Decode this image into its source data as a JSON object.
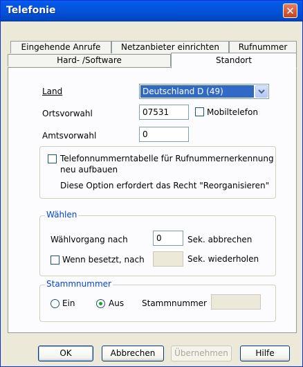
{
  "window": {
    "title": "Telefonie"
  },
  "tabs": {
    "row_back": [
      "Eingehende Anrufe",
      "Netzanbieter einrichten",
      "Rufnummer"
    ],
    "row_front": [
      "Hard- /Software",
      "Standort"
    ],
    "active": "Standort"
  },
  "location": {
    "country_label": "Land",
    "country_value": "Deutschland D (49)",
    "area_code_label": "Ortsvorwahl",
    "area_code_value": "07531",
    "mobile_label": "Mobiltelefon",
    "mobile_checked": false,
    "outside_line_label": "Amtsvorwahl",
    "outside_line_value": "0"
  },
  "rebuild": {
    "checkbox_label_line1": "Telefonnummerntabelle für Rufnummernerkennung",
    "checkbox_label_line2": "neu aufbauen",
    "checked": false,
    "note": "Diese Option erfordert das Recht \"Reorganisieren\""
  },
  "dialing": {
    "legend": "Wählen",
    "abort_label": "Wählvorgang nach",
    "abort_value": "0",
    "abort_suffix": "Sek. abbrechen",
    "busy_label": "Wenn besetzt, nach",
    "busy_checked": false,
    "busy_value": "",
    "busy_suffix": "Sek. wiederholen"
  },
  "trunk": {
    "legend": "Stammnummer",
    "on_label": "Ein",
    "off_label": "Aus",
    "selected": "Aus",
    "number_label": "Stammnummer",
    "number_value": ""
  },
  "buttons": {
    "ok": "OK",
    "cancel": "Abbrechen",
    "apply": "Übernehmen",
    "help": "Hilfe"
  }
}
